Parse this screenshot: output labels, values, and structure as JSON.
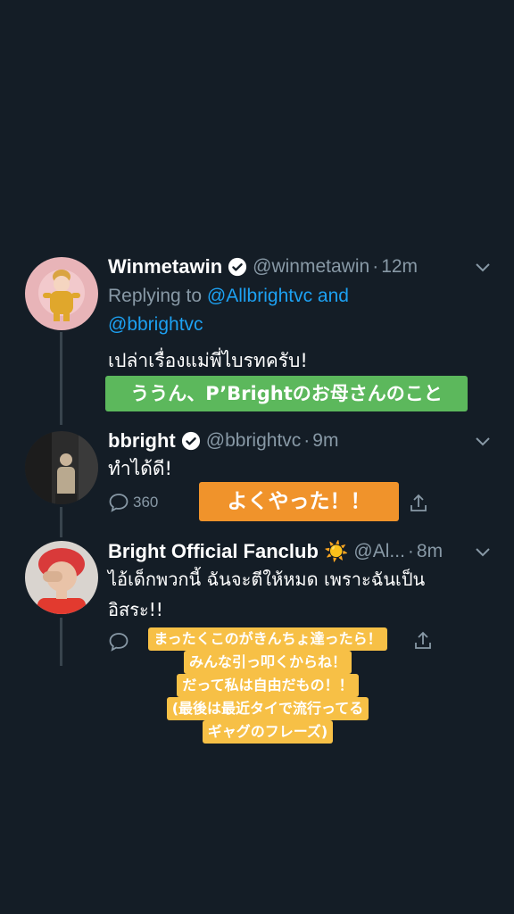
{
  "tweets": [
    {
      "display_name": "Winmetawin",
      "handle": "@winmetawin",
      "time": "12m",
      "reply_prefix": "Replying to ",
      "reply_mention_1": "@Allbrightvc",
      "reply_joiner": " and",
      "reply_mention_2": "@bbrightvc",
      "text": "เปล่าเรื่องแม่พี่ไบรทครับ!",
      "caption": "ううん、P’Brightのお母さんのこと"
    },
    {
      "display_name": "bbright",
      "handle": "@bbrightvc",
      "time": "9m",
      "text": "ทำได้ดี!",
      "reply_count": "360",
      "caption": "よくやった！！"
    },
    {
      "display_name": "Bright Official Fanclub ☀️",
      "handle": "@Al...",
      "time": "8m",
      "text_line_1": "ไอ้เด็กพวกนี้ ฉันจะตีให้หมด เพราะฉันเป็น",
      "text_line_2": "อิสระ!!",
      "caption_lines": [
        "まったくこのがきんちょ達ったら！",
        "みんな引っ叩くからね！",
        "だって私は自由だもの！！",
        "(最後は最近タイで流行ってる",
        "ギャグのフレーズ)"
      ]
    }
  ],
  "colors": {
    "background": "#141d26",
    "secondary_text": "#8899a6",
    "link": "#1da1f2",
    "caption_green": "#5cb85c",
    "caption_orange": "#f0932b",
    "caption_yellow": "#f7c046"
  },
  "icons": [
    "verified-badge-icon",
    "chevron-down-icon",
    "reply-icon",
    "share-icon",
    "sun-emoji"
  ]
}
